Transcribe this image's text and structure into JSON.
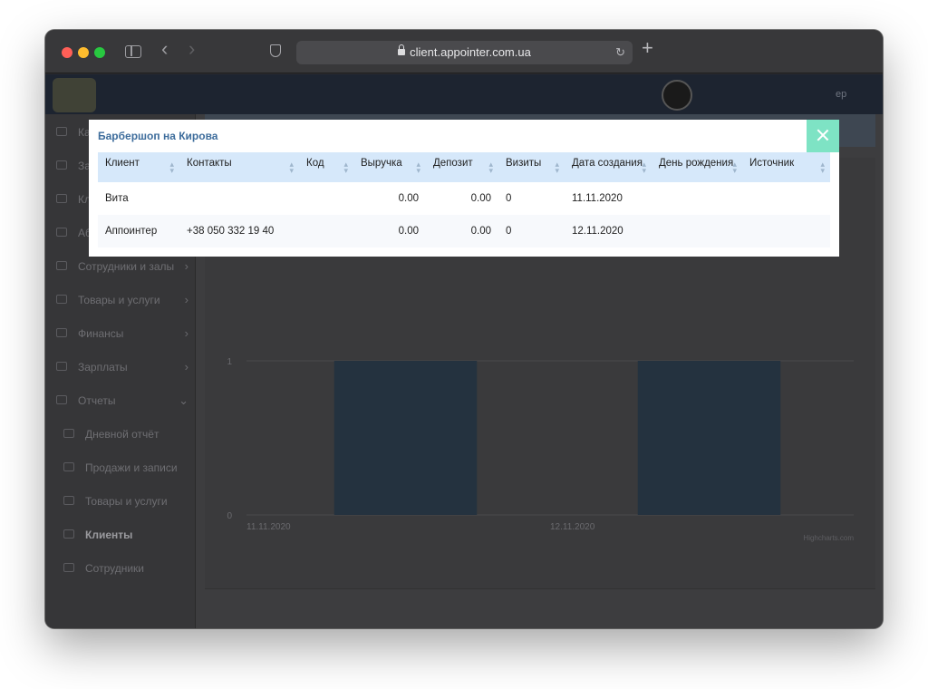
{
  "browser": {
    "url": "client.appointer.com.ua"
  },
  "header": {
    "user_label": "ер"
  },
  "sidebar": {
    "items": [
      {
        "label": "Ка",
        "chevron": false
      },
      {
        "label": "За",
        "chevron": false
      },
      {
        "label": "Кл",
        "chevron": false
      },
      {
        "label": "Абонементы",
        "chevron": false
      },
      {
        "label": "Сотрудники и залы",
        "chevron": true
      },
      {
        "label": "Товары и услуги",
        "chevron": true
      },
      {
        "label": "Финансы",
        "chevron": true
      },
      {
        "label": "Зарплаты",
        "chevron": true
      },
      {
        "label": "Отчеты",
        "chevron": true
      }
    ],
    "subitems": [
      {
        "label": "Дневной отчёт",
        "active": false
      },
      {
        "label": "Продажи и записи",
        "active": false
      },
      {
        "label": "Товары и услуги",
        "active": false
      },
      {
        "label": "Клиенты",
        "active": true
      },
      {
        "label": "Сотрудники",
        "active": false
      }
    ]
  },
  "chart_data": {
    "type": "bar",
    "categories": [
      "11.11.2020",
      "12.11.2020"
    ],
    "values": [
      1,
      1
    ],
    "ylim": [
      0,
      1
    ],
    "yticks": [
      "1",
      "0"
    ],
    "credit": "Highcharts.com"
  },
  "modal": {
    "title": "Барбершоп на Кирова",
    "columns": [
      "Клиент",
      "Контакты",
      "Код",
      "Выручка",
      "Депозит",
      "Визиты",
      "Дата создания",
      "День рождения",
      "Источник"
    ],
    "rows": [
      [
        "Вита",
        "",
        "",
        "0.00",
        "0.00",
        "0",
        "11.11.2020",
        "",
        ""
      ],
      [
        "Аппоинтер",
        "+38 050 332 19 40",
        "",
        "0.00",
        "0.00",
        "0",
        "12.11.2020",
        "",
        ""
      ]
    ]
  },
  "colors": {
    "modal_title": "#3e6d9c",
    "table_header_bg": "#d6e8fa",
    "close_button": "#7ee3c4",
    "bar_color": "#24323f"
  }
}
